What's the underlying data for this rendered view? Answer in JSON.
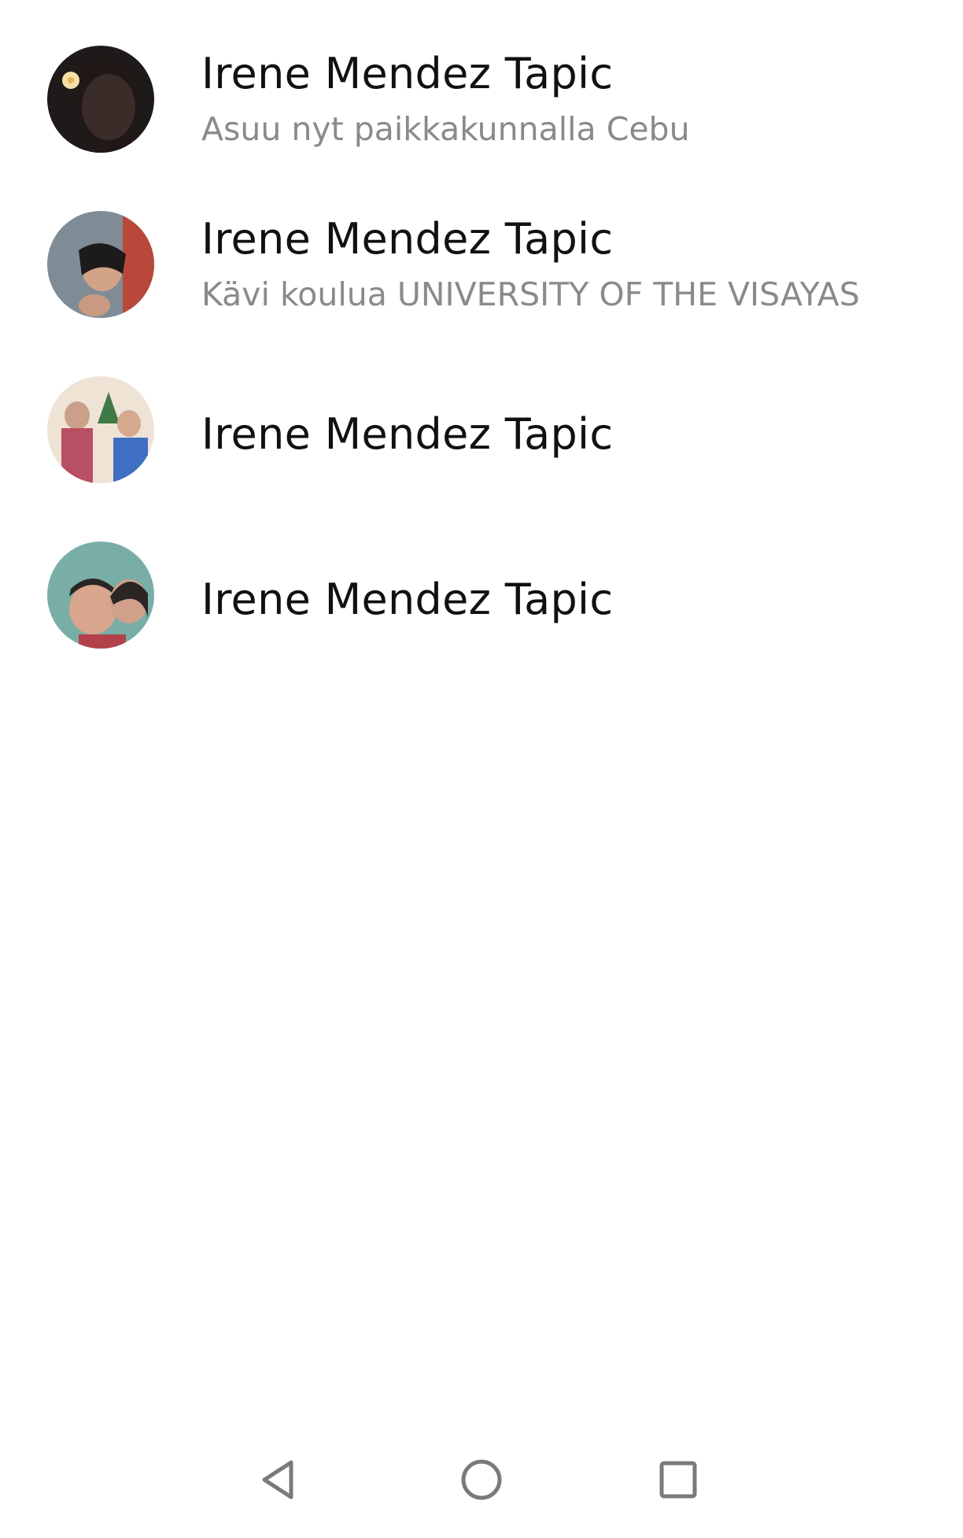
{
  "results": [
    {
      "name": "Irene Mendez Tapic",
      "subtitle": "Asuu nyt paikkakunnalla Cebu",
      "avatar_colors": [
        "#3a2a26",
        "#c98f7a",
        "#f2d9a0"
      ]
    },
    {
      "name": "Irene Mendez Tapic",
      "subtitle": "Kävi koulua UNIVERSITY OF THE VISAYAS",
      "avatar_colors": [
        "#5a6a78",
        "#8a94a0",
        "#c0503a"
      ]
    },
    {
      "name": "Irene Mendez Tapic",
      "subtitle": "",
      "avatar_colors": [
        "#e7d6c9",
        "#b64a5a",
        "#3d6fc0"
      ]
    },
    {
      "name": "Irene Mendez Tapic",
      "subtitle": "",
      "avatar_colors": [
        "#6fa8a2",
        "#d9a58c",
        "#3c3a3a"
      ]
    }
  ],
  "navigation": {
    "back_icon": "triangle-back-icon",
    "home_icon": "circle-home-icon",
    "recents_icon": "square-recents-icon",
    "icon_color": "#7a7a7a"
  }
}
